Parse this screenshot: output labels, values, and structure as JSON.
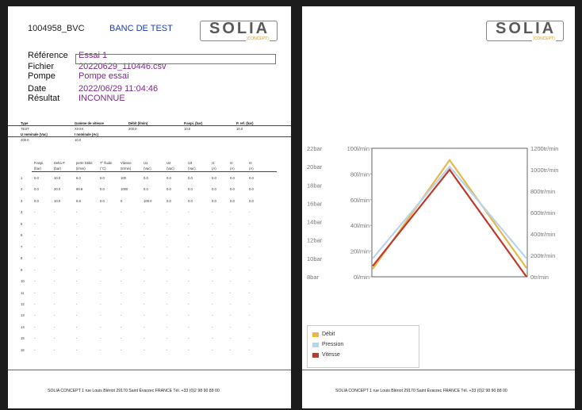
{
  "left_page": {
    "doc_code": "1004958_BVC",
    "doc_title": "BANC DE TEST",
    "logo_text": "SOLIA",
    "logo_sub": ")CONCEPT)",
    "fields": [
      {
        "label": "Référence",
        "value": "Essai 1"
      },
      {
        "label": "Fichier",
        "value": "20220629_110446.csv"
      },
      {
        "label": "Pompe",
        "value": "Pompe essai"
      },
      {
        "label": "Date",
        "value": "2022/06/29 11:04:46"
      },
      {
        "label": "Résultat",
        "value": "INCONNUE"
      }
    ],
    "summary": {
      "headers": [
        "Type",
        "Gamme de vitesse",
        "Débit (l/min)",
        "P.aspi. (bar)",
        "P. ref. (bar)"
      ],
      "values": [
        "TEST",
        "XXXX",
        "200.0",
        "10.0",
        "10.0"
      ],
      "headers2": [
        "U nominale (Vac)",
        "I nominale (Ac)"
      ],
      "values2": [
        "400.0",
        "10.0"
      ]
    },
    "table": {
      "headers": [
        [
          "P.aspi.",
          "(bar)"
        ],
        [
          "Delta P.",
          "(bar)"
        ],
        [
          "perte Débit",
          "(l/min)"
        ],
        [
          "T° fluide",
          "(°C)"
        ],
        [
          "Vitesse",
          "(tr/min)"
        ],
        [
          "U1",
          "(Vac)"
        ],
        [
          "U2",
          "(Vac)"
        ],
        [
          "U3",
          "(Vac)"
        ],
        [
          "I1",
          "(A)"
        ],
        [
          "I2",
          "(A)"
        ],
        [
          "I3",
          "(A)"
        ]
      ],
      "rows": [
        [
          "1",
          "0.0",
          "10.0",
          "6.0",
          "0.0",
          "100",
          "0.0",
          "0.0",
          "0.0",
          "0.0",
          "0.0",
          "0.0"
        ],
        [
          "2",
          "0.0",
          "20.0",
          "90.8",
          "0.0",
          "1000",
          "0.0",
          "0.0",
          "0.0",
          "0.0",
          "0.0",
          "0.0"
        ],
        [
          "3",
          "0.0",
          "10.0",
          "6.8",
          "0.0",
          "0",
          "100.0",
          "0.0",
          "0.0",
          "0.0",
          "0.0",
          "0.0"
        ],
        [
          "4",
          "-",
          "-",
          "-",
          "-",
          "-",
          "-",
          "-",
          "-",
          "-",
          "-",
          "-"
        ],
        [
          "5",
          "-",
          "-",
          "-",
          "-",
          "-",
          "-",
          "-",
          "-",
          "-",
          "-",
          "-"
        ],
        [
          "6",
          "-",
          "-",
          "-",
          "-",
          "-",
          "-",
          "-",
          "-",
          "-",
          "-",
          "-"
        ],
        [
          "7",
          "-",
          "-",
          "-",
          "-",
          "-",
          "-",
          "-",
          "-",
          "-",
          "-",
          "-"
        ],
        [
          "8",
          "-",
          "-",
          "-",
          "-",
          "-",
          "-",
          "-",
          "-",
          "-",
          "-",
          "-"
        ],
        [
          "9",
          "-",
          "-",
          "-",
          "-",
          "-",
          "-",
          "-",
          "-",
          "-",
          "-",
          "-"
        ],
        [
          "10",
          "-",
          "-",
          "-",
          "-",
          "-",
          "-",
          "-",
          "-",
          "-",
          "-",
          "-"
        ],
        [
          "11",
          "-",
          "-",
          "-",
          "-",
          "-",
          "-",
          "-",
          "-",
          "-",
          "-",
          "-"
        ],
        [
          "12",
          "-",
          "-",
          "-",
          "-",
          "-",
          "-",
          "-",
          "-",
          "-",
          "-",
          "-"
        ],
        [
          "13",
          "-",
          "-",
          "-",
          "-",
          "-",
          "-",
          "-",
          "-",
          "-",
          "-",
          "-"
        ],
        [
          "14",
          "-",
          "-",
          "-",
          "-",
          "-",
          "-",
          "-",
          "-",
          "-",
          "-",
          "-"
        ],
        [
          "15",
          "-",
          "-",
          "-",
          "-",
          "-",
          "-",
          "-",
          "-",
          "-",
          "-",
          "-"
        ],
        [
          "16",
          "-",
          "-",
          "-",
          "-",
          "-",
          "-",
          "-",
          "-",
          "-",
          "-",
          "-"
        ]
      ]
    },
    "footer": "SOLIA CONCEPT 1 rue Louis Blériot 29170 Saint Évarzec FRANCE Tél. +33 (0)2 98 90 88 00"
  },
  "right_page": {
    "logo_text": "SOLIA",
    "logo_sub": ")CONCEPT)",
    "footer": "SOLIA CONCEPT 1 rue Louis Blériot 29170 Saint Évarzec FRANCE Tél. +33 (0)2 98 90 88 00"
  },
  "chart_data": {
    "type": "line",
    "x": [
      1,
      2,
      3
    ],
    "axes": {
      "pression": {
        "ticks": [
          "8bar",
          "10bar",
          "12bar",
          "14bar",
          "16bar",
          "18bar",
          "20bar",
          "22bar"
        ],
        "ylim": [
          8,
          22
        ]
      },
      "debit": {
        "ticks": [
          "0l/min",
          "20l/min",
          "40l/min",
          "60l/min",
          "80l/min",
          "100l/min"
        ],
        "ylim": [
          0,
          100
        ]
      },
      "vitesse": {
        "ticks": [
          "0tr/min",
          "200tr/min",
          "400tr/min",
          "600tr/min",
          "800tr/min",
          "1000tr/min",
          "1200tr/min"
        ],
        "ylim": [
          0,
          1200
        ]
      }
    },
    "series": [
      {
        "name": "Débit",
        "axis": "debit",
        "values": [
          6.0,
          90.8,
          6.8
        ],
        "color": "#e8b84a"
      },
      {
        "name": "Pression",
        "axis": "pression",
        "values": [
          10.0,
          20.0,
          10.0
        ],
        "color": "#b8d4ec"
      },
      {
        "name": "Vitesse",
        "axis": "vitesse",
        "values": [
          100,
          1000,
          0
        ],
        "color": "#c0392b"
      }
    ],
    "legend_position": "bottom-left",
    "grid": false
  },
  "colors": {
    "title_blue": "#1a3fb0",
    "value_purple": "#7a2a8c",
    "logo_green": "#8cb84a",
    "logo_orange": "#d89a2a"
  }
}
